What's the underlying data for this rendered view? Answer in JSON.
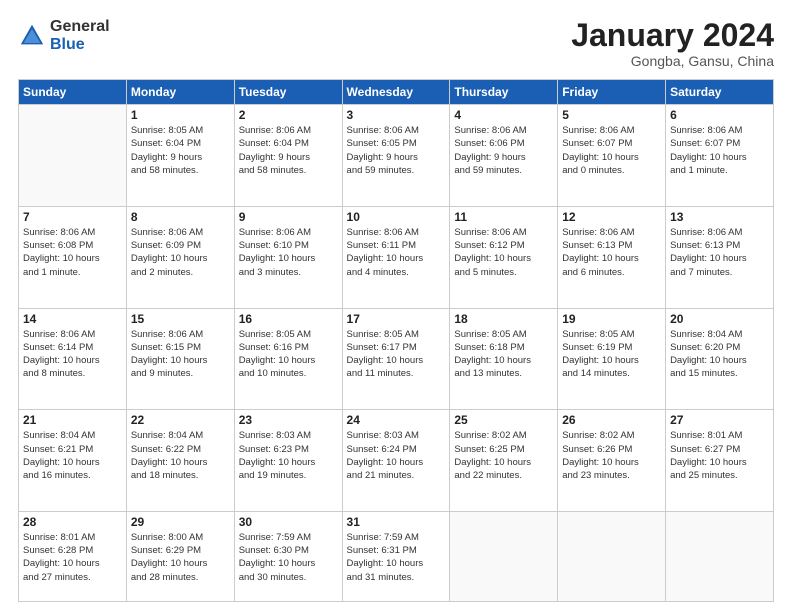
{
  "header": {
    "logo_general": "General",
    "logo_blue": "Blue",
    "month_title": "January 2024",
    "location": "Gongba, Gansu, China"
  },
  "days_of_week": [
    "Sunday",
    "Monday",
    "Tuesday",
    "Wednesday",
    "Thursday",
    "Friday",
    "Saturday"
  ],
  "weeks": [
    [
      {
        "day": "",
        "info": ""
      },
      {
        "day": "1",
        "info": "Sunrise: 8:05 AM\nSunset: 6:04 PM\nDaylight: 9 hours\nand 58 minutes."
      },
      {
        "day": "2",
        "info": "Sunrise: 8:06 AM\nSunset: 6:04 PM\nDaylight: 9 hours\nand 58 minutes."
      },
      {
        "day": "3",
        "info": "Sunrise: 8:06 AM\nSunset: 6:05 PM\nDaylight: 9 hours\nand 59 minutes."
      },
      {
        "day": "4",
        "info": "Sunrise: 8:06 AM\nSunset: 6:06 PM\nDaylight: 9 hours\nand 59 minutes."
      },
      {
        "day": "5",
        "info": "Sunrise: 8:06 AM\nSunset: 6:07 PM\nDaylight: 10 hours\nand 0 minutes."
      },
      {
        "day": "6",
        "info": "Sunrise: 8:06 AM\nSunset: 6:07 PM\nDaylight: 10 hours\nand 1 minute."
      }
    ],
    [
      {
        "day": "7",
        "info": "Sunrise: 8:06 AM\nSunset: 6:08 PM\nDaylight: 10 hours\nand 1 minute."
      },
      {
        "day": "8",
        "info": "Sunrise: 8:06 AM\nSunset: 6:09 PM\nDaylight: 10 hours\nand 2 minutes."
      },
      {
        "day": "9",
        "info": "Sunrise: 8:06 AM\nSunset: 6:10 PM\nDaylight: 10 hours\nand 3 minutes."
      },
      {
        "day": "10",
        "info": "Sunrise: 8:06 AM\nSunset: 6:11 PM\nDaylight: 10 hours\nand 4 minutes."
      },
      {
        "day": "11",
        "info": "Sunrise: 8:06 AM\nSunset: 6:12 PM\nDaylight: 10 hours\nand 5 minutes."
      },
      {
        "day": "12",
        "info": "Sunrise: 8:06 AM\nSunset: 6:13 PM\nDaylight: 10 hours\nand 6 minutes."
      },
      {
        "day": "13",
        "info": "Sunrise: 8:06 AM\nSunset: 6:13 PM\nDaylight: 10 hours\nand 7 minutes."
      }
    ],
    [
      {
        "day": "14",
        "info": "Sunrise: 8:06 AM\nSunset: 6:14 PM\nDaylight: 10 hours\nand 8 minutes."
      },
      {
        "day": "15",
        "info": "Sunrise: 8:06 AM\nSunset: 6:15 PM\nDaylight: 10 hours\nand 9 minutes."
      },
      {
        "day": "16",
        "info": "Sunrise: 8:05 AM\nSunset: 6:16 PM\nDaylight: 10 hours\nand 10 minutes."
      },
      {
        "day": "17",
        "info": "Sunrise: 8:05 AM\nSunset: 6:17 PM\nDaylight: 10 hours\nand 11 minutes."
      },
      {
        "day": "18",
        "info": "Sunrise: 8:05 AM\nSunset: 6:18 PM\nDaylight: 10 hours\nand 13 minutes."
      },
      {
        "day": "19",
        "info": "Sunrise: 8:05 AM\nSunset: 6:19 PM\nDaylight: 10 hours\nand 14 minutes."
      },
      {
        "day": "20",
        "info": "Sunrise: 8:04 AM\nSunset: 6:20 PM\nDaylight: 10 hours\nand 15 minutes."
      }
    ],
    [
      {
        "day": "21",
        "info": "Sunrise: 8:04 AM\nSunset: 6:21 PM\nDaylight: 10 hours\nand 16 minutes."
      },
      {
        "day": "22",
        "info": "Sunrise: 8:04 AM\nSunset: 6:22 PM\nDaylight: 10 hours\nand 18 minutes."
      },
      {
        "day": "23",
        "info": "Sunrise: 8:03 AM\nSunset: 6:23 PM\nDaylight: 10 hours\nand 19 minutes."
      },
      {
        "day": "24",
        "info": "Sunrise: 8:03 AM\nSunset: 6:24 PM\nDaylight: 10 hours\nand 21 minutes."
      },
      {
        "day": "25",
        "info": "Sunrise: 8:02 AM\nSunset: 6:25 PM\nDaylight: 10 hours\nand 22 minutes."
      },
      {
        "day": "26",
        "info": "Sunrise: 8:02 AM\nSunset: 6:26 PM\nDaylight: 10 hours\nand 23 minutes."
      },
      {
        "day": "27",
        "info": "Sunrise: 8:01 AM\nSunset: 6:27 PM\nDaylight: 10 hours\nand 25 minutes."
      }
    ],
    [
      {
        "day": "28",
        "info": "Sunrise: 8:01 AM\nSunset: 6:28 PM\nDaylight: 10 hours\nand 27 minutes."
      },
      {
        "day": "29",
        "info": "Sunrise: 8:00 AM\nSunset: 6:29 PM\nDaylight: 10 hours\nand 28 minutes."
      },
      {
        "day": "30",
        "info": "Sunrise: 7:59 AM\nSunset: 6:30 PM\nDaylight: 10 hours\nand 30 minutes."
      },
      {
        "day": "31",
        "info": "Sunrise: 7:59 AM\nSunset: 6:31 PM\nDaylight: 10 hours\nand 31 minutes."
      },
      {
        "day": "",
        "info": ""
      },
      {
        "day": "",
        "info": ""
      },
      {
        "day": "",
        "info": ""
      }
    ]
  ]
}
